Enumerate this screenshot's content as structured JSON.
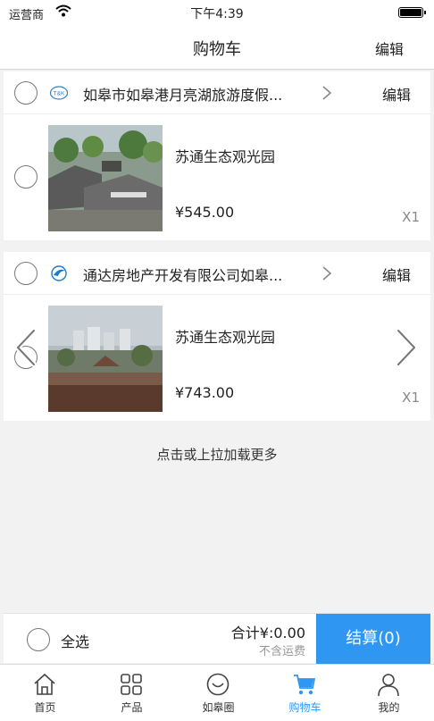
{
  "status_bar": {
    "carrier": "运营商",
    "time": "下午4:39"
  },
  "nav": {
    "title": "购物车",
    "edit": "编辑"
  },
  "shops": [
    {
      "name": "如皋市如皋港月亮湖旅游度假...",
      "edit": "编辑",
      "logo_text": "T&K",
      "item": {
        "name": "苏通生态观光园",
        "price": "¥545.00",
        "qty": "X1"
      }
    },
    {
      "name": "通达房地产开发有限公司如皋...",
      "edit": "编辑",
      "item": {
        "name": "苏通生态观光园",
        "price": "¥743.00",
        "qty": "X1"
      }
    }
  ],
  "load_more": "点击或上拉加载更多",
  "footer": {
    "select_all": "全选",
    "total": "合计¥:0.00",
    "shipping": "不含运费",
    "checkout": "结算(0)"
  },
  "tabs": [
    {
      "label": "首页",
      "icon": "home-icon"
    },
    {
      "label": "产品",
      "icon": "grid-icon"
    },
    {
      "label": "如皋圈",
      "icon": "smile-circle-icon"
    },
    {
      "label": "购物车",
      "icon": "cart-icon",
      "active": true
    },
    {
      "label": "我的",
      "icon": "person-icon"
    }
  ],
  "colors": {
    "accent": "#2f96f2",
    "background": "#f2f2f2"
  }
}
